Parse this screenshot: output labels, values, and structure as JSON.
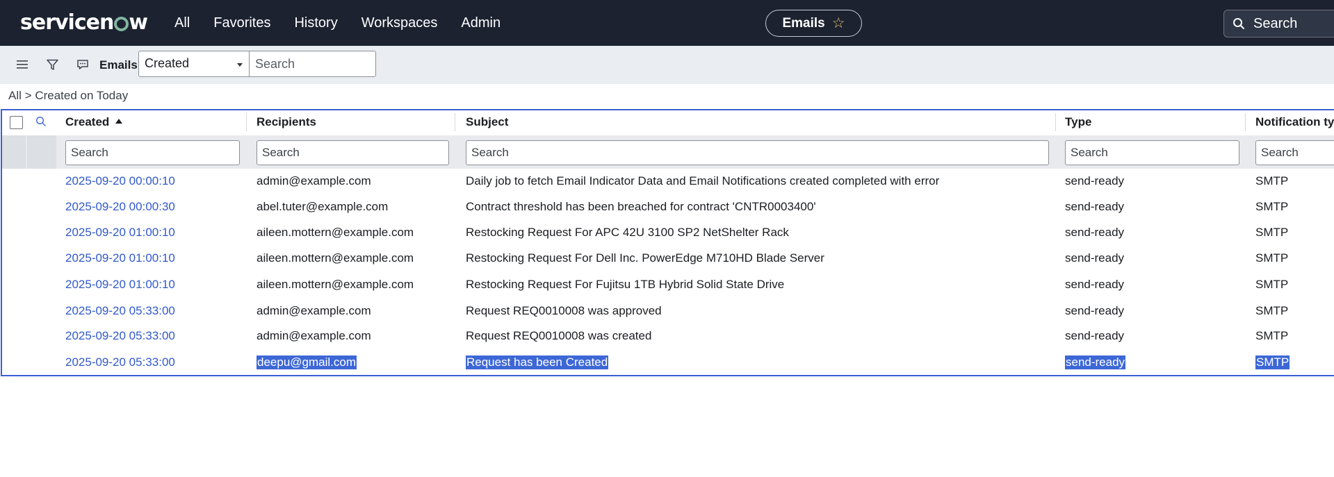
{
  "app": {
    "logo_text": "servicenow"
  },
  "nav": {
    "items": [
      "All",
      "Favorites",
      "History",
      "Workspaces",
      "Admin"
    ]
  },
  "context_pill": {
    "label": "Emails"
  },
  "global_search": {
    "placeholder": "Search"
  },
  "list": {
    "title": "Emails",
    "field_select": "Created",
    "search_placeholder": "Search",
    "breadcrumb": {
      "root": "All",
      "separator": ">",
      "filter": "Created on Today"
    }
  },
  "table": {
    "columns": [
      "Created",
      "Recipients",
      "Subject",
      "Type",
      "Notification typ"
    ],
    "filter_placeholder": "Search",
    "rows": [
      {
        "created": "2025-09-20 00:00:10",
        "recipients": "admin@example.com",
        "subject": "Daily job to fetch Email Indicator Data and Email Notifications created completed with error",
        "type": "send-ready",
        "notification_type": "SMTP"
      },
      {
        "created": "2025-09-20 00:00:30",
        "recipients": "abel.tuter@example.com",
        "subject": "Contract threshold has been breached for contract 'CNTR0003400'",
        "type": "send-ready",
        "notification_type": "SMTP"
      },
      {
        "created": "2025-09-20 01:00:10",
        "recipients": "aileen.mottern@example.com",
        "subject": "Restocking Request For APC 42U 3100 SP2 NetShelter Rack",
        "type": "send-ready",
        "notification_type": "SMTP"
      },
      {
        "created": "2025-09-20 01:00:10",
        "recipients": "aileen.mottern@example.com",
        "subject": "Restocking Request For Dell Inc. PowerEdge M710HD Blade Server",
        "type": "send-ready",
        "notification_type": "SMTP"
      },
      {
        "created": "2025-09-20 01:00:10",
        "recipients": "aileen.mottern@example.com",
        "subject": "Restocking Request For Fujitsu 1TB Hybrid Solid State Drive",
        "type": "send-ready",
        "notification_type": "SMTP"
      },
      {
        "created": "2025-09-20 05:33:00",
        "recipients": "admin@example.com",
        "subject": "Request REQ0010008 was approved",
        "type": "send-ready",
        "notification_type": "SMTP"
      },
      {
        "created": "2025-09-20 05:33:00",
        "recipients": "admin@example.com",
        "subject": "Request REQ0010008 was created",
        "type": "send-ready",
        "notification_type": "SMTP"
      },
      {
        "created": "2025-09-20 05:33:00",
        "recipients": "deepu@gmail.com",
        "subject": "Request has been Created",
        "type": "send-ready",
        "notification_type": "SMTP",
        "selected": true
      }
    ]
  },
  "colors": {
    "nav_bg": "#1c2230",
    "link": "#3159c9",
    "selection": "#3d67d6",
    "table_border": "#3a5fd3",
    "logo_accent": "#81b5a1"
  },
  "icons": [
    "menu-icon",
    "filter-icon",
    "comment-icon",
    "search-icon",
    "star-icon",
    "sort-ascending-icon"
  ]
}
